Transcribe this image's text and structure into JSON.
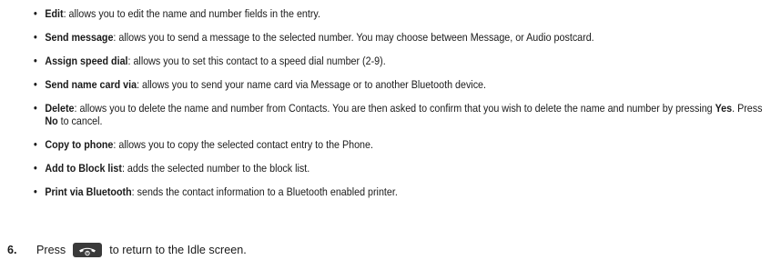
{
  "bullets": [
    {
      "term": "Edit",
      "text": ": allows you to edit the name and number fields in the entry."
    },
    {
      "term": "Send message",
      "text": ": allows you to send a message to the selected number. You may choose between Message, or Audio postcard."
    },
    {
      "term": "Assign speed dial",
      "text": ": allows you to set this contact to a speed dial number (2-9)."
    },
    {
      "term": "Send name card via",
      "text": ": allows you to send your name card via Message or to another Bluetooth device."
    },
    {
      "term": "Delete",
      "text_a": ": allows you to delete the name and number from Contacts. You are then asked to confirm that you wish to delete the name and number by pressing ",
      "bold_a": "Yes",
      "text_b": ". Press ",
      "bold_b": "No",
      "text_c": " to cancel."
    },
    {
      "term": "Copy to phone",
      "text": ": allows you to copy the selected contact entry to the Phone."
    },
    {
      "term": "Add to Block list",
      "text": ": adds the selected number to the block list."
    },
    {
      "term": "Print via Bluetooth",
      "text": ": sends the contact information to a Bluetooth enabled printer."
    }
  ],
  "step": {
    "number": "6.",
    "before": "Press",
    "after": "to return to the Idle screen.",
    "icon": "end-call-key-icon"
  }
}
